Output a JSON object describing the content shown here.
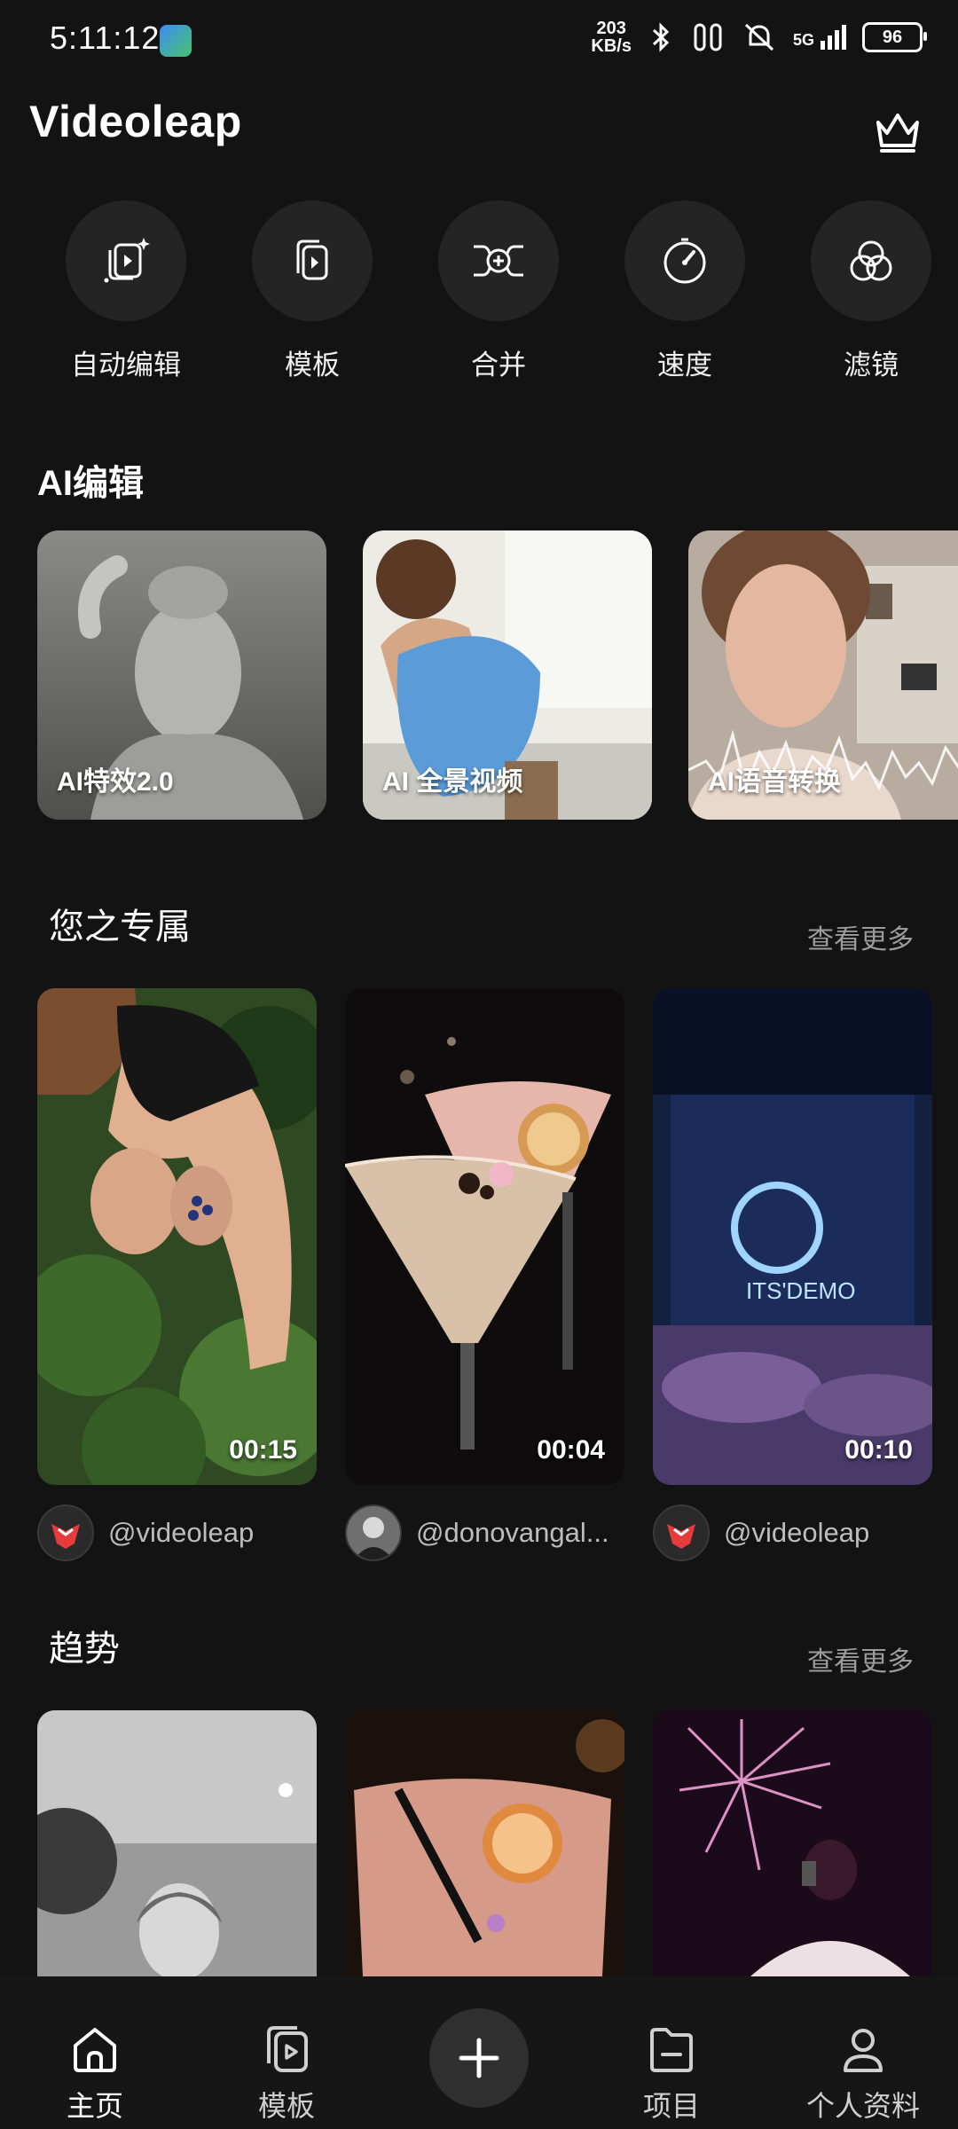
{
  "status": {
    "time": "5:11:12",
    "speed_top": "203",
    "speed_bottom": "KB/s",
    "network": "5G",
    "battery": "96"
  },
  "header": {
    "title": "Videoleap",
    "icon": "crown-icon"
  },
  "tools": [
    {
      "label": "自动编辑",
      "icon": "auto-edit-icon"
    },
    {
      "label": "模板",
      "icon": "template-icon"
    },
    {
      "label": "合并",
      "icon": "merge-icon"
    },
    {
      "label": "速度",
      "icon": "speed-icon"
    },
    {
      "label": "滤镜",
      "icon": "filter-icon"
    }
  ],
  "ai_section": {
    "title": "AI编辑",
    "cards": [
      {
        "label": "AI特效2.0"
      },
      {
        "label": "AI 全景视频"
      },
      {
        "label": "AI语音转换"
      }
    ]
  },
  "for_you": {
    "title": "您之专属",
    "see_more": "查看更多",
    "videos": [
      {
        "duration": "00:15",
        "author": "@videoleap"
      },
      {
        "duration": "00:04",
        "author": "@donovangal..."
      },
      {
        "duration": "00:10",
        "author": "@videoleap"
      }
    ]
  },
  "trending": {
    "title": "趋势",
    "see_more": "查看更多"
  },
  "nav": {
    "home": "主页",
    "templates": "模板",
    "projects": "项目",
    "profile": "个人资料"
  },
  "colors": {
    "background": "#131313",
    "tool_circle": "#242424",
    "muted_text": "#9c9c9c"
  }
}
